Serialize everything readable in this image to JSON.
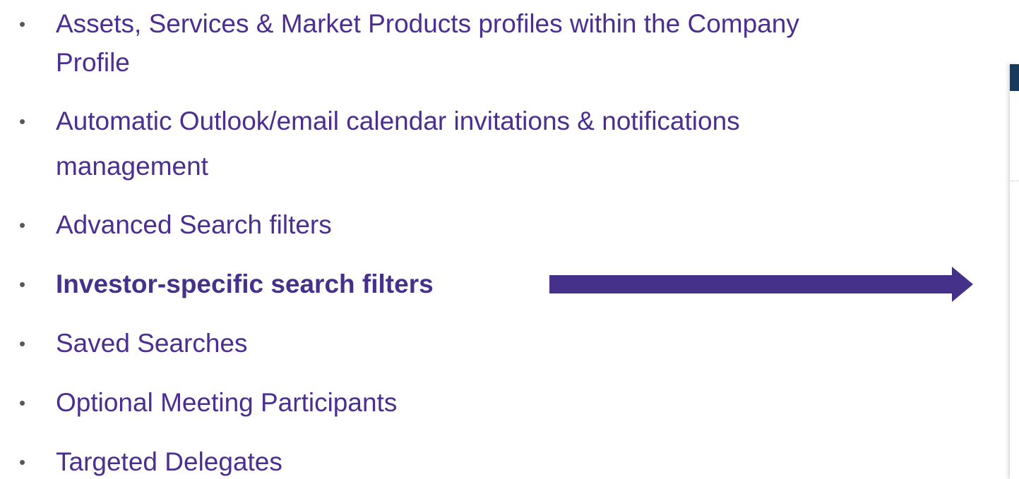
{
  "bullets": [
    {
      "line1": "Assets, Services & Market Products profiles within the Company",
      "line2": "Profile",
      "bold": false
    },
    {
      "line1": "Automatic Outlook/email calendar invitations & notifications",
      "line2": "management",
      "bold": false
    },
    {
      "line1": "Advanced Search filters",
      "bold": false
    },
    {
      "line1": "Investor-specific search filters",
      "bold": true
    },
    {
      "line1": "Saved Searches",
      "bold": false
    },
    {
      "line1": "Optional Meeting Participants",
      "bold": false
    },
    {
      "line1": "Targeted Delegates",
      "bold": false
    }
  ],
  "bullet_glyph": "•",
  "colors": {
    "text": "#4b2e8f",
    "arrow": "#46318a",
    "panel_header": "#1a3a5c"
  }
}
